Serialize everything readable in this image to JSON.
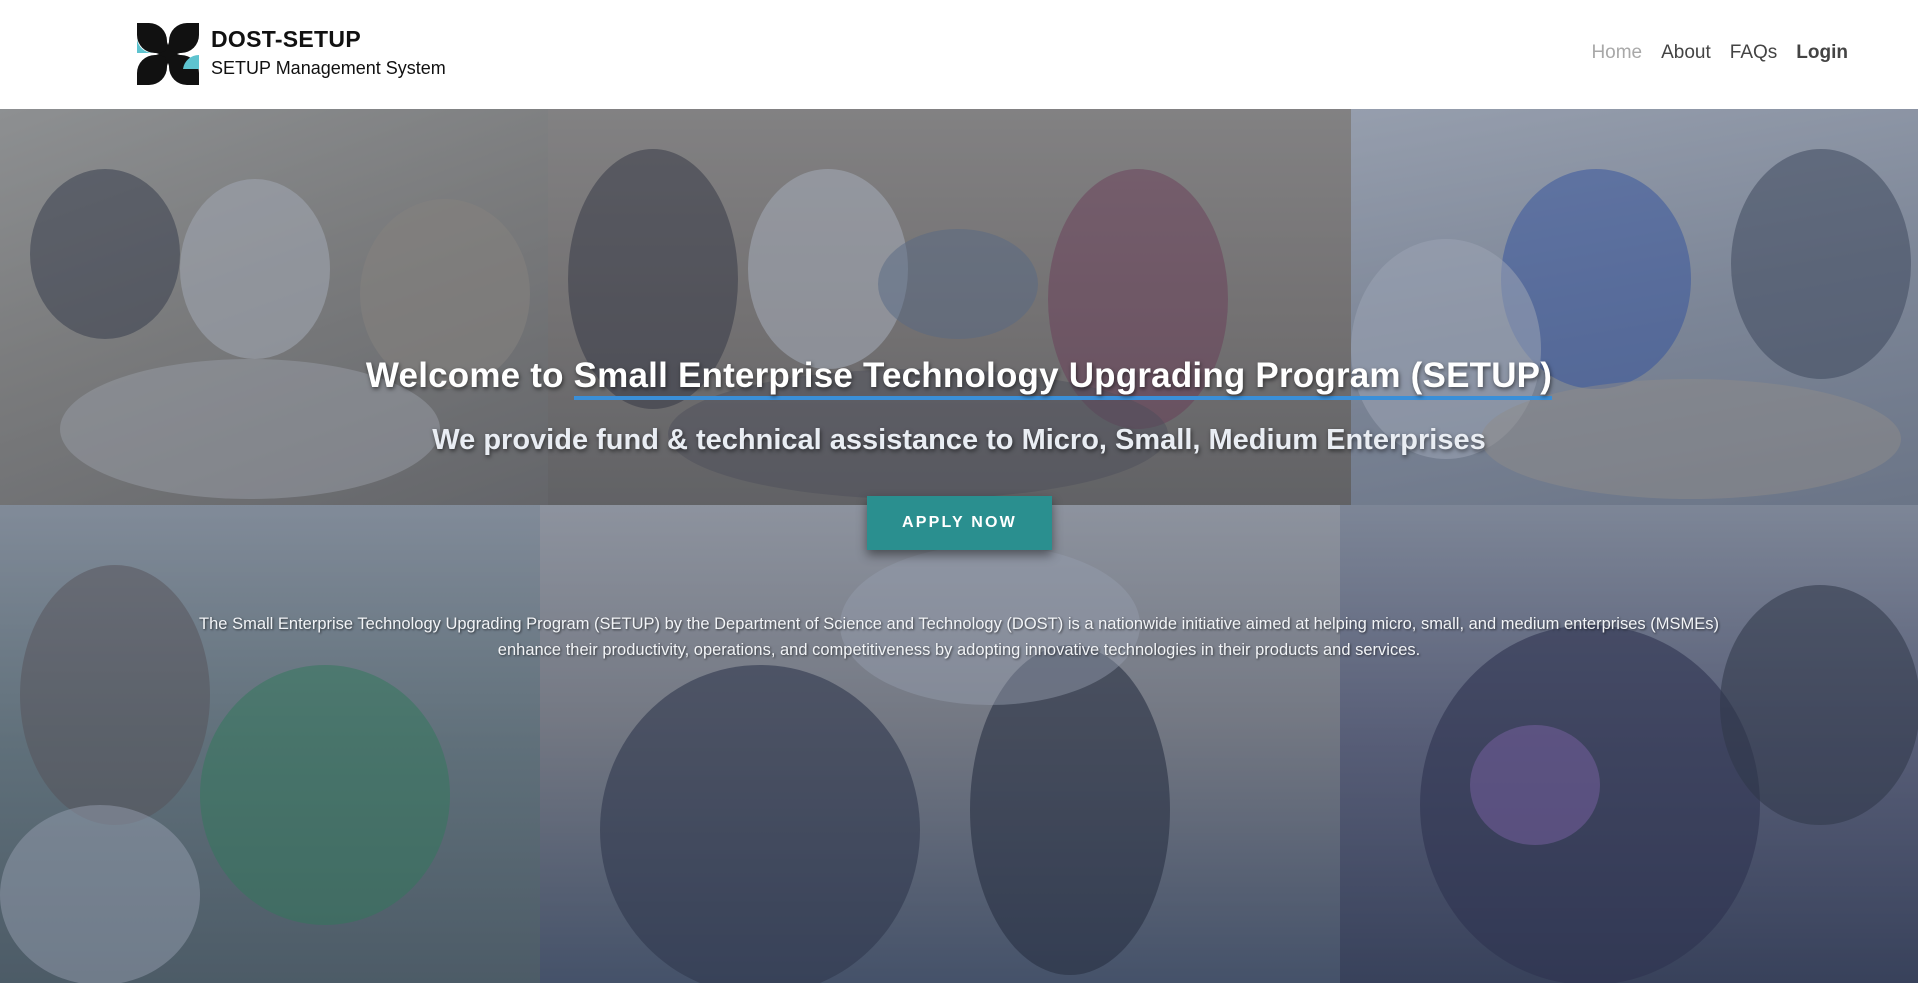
{
  "header": {
    "brand_title": "DOST-SETUP",
    "brand_subtitle": "SETUP Management System",
    "logo_icon": "dost-logo-icon",
    "nav": [
      {
        "label": "Home",
        "active": true
      },
      {
        "label": "About",
        "active": false
      },
      {
        "label": "FAQs",
        "active": false
      },
      {
        "label": "Login",
        "active": false
      }
    ]
  },
  "hero": {
    "title_prefix": "Welcome to ",
    "title_highlight": "Small Enterprise Technology Upgrading Program (SETUP)",
    "subtitle": "We provide fund & technical assistance to Micro, Small, Medium Enterprises",
    "apply_label": "APPLY NOW",
    "description": "The Small Enterprise Technology Upgrading Program (SETUP) by the Department of Science and Technology (DOST) is a nationwide initiative aimed at helping micro, small, and medium enterprises (MSMEs) enhance their productivity, operations, and competitiveness by adopting innovative technologies in their products and services."
  },
  "colors": {
    "logo_dark": "#111111",
    "logo_accent": "#5ec3cf",
    "title_underline": "#3a8fd8",
    "apply_button": "#2a8f8f",
    "nav_active": "#a8a8a8",
    "nav_text": "#444444"
  }
}
